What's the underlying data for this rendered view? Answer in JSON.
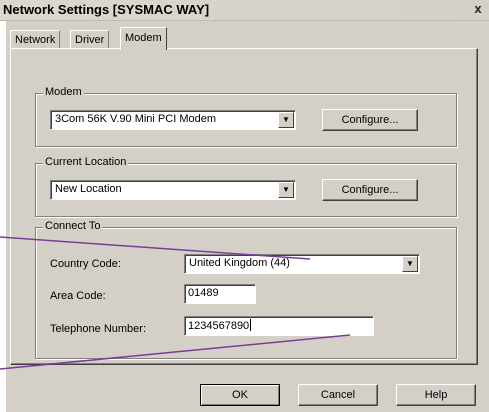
{
  "window": {
    "title": "Network Settings [SYSMAC WAY]",
    "close_glyph": "x"
  },
  "tabs": [
    "Network",
    "Driver",
    "Modem"
  ],
  "modem_group": {
    "legend": "Modem",
    "selected": "3Com 56K V.90 Mini PCI Modem",
    "configure_label": "Configure..."
  },
  "location_group": {
    "legend": "Current Location",
    "selected": "New Location",
    "configure_label": "Configure..."
  },
  "connect_group": {
    "legend": "Connect To",
    "country_label": "Country Code:",
    "country_value": "United Kingdom (44)",
    "area_label": "Area Code:",
    "area_value": "01489",
    "phone_label": "Telephone Number:",
    "phone_value": "1234567890"
  },
  "buttons": {
    "ok": "OK",
    "cancel": "Cancel",
    "help": "Help"
  },
  "colors": {
    "dialog_bg": "#d4d0c8",
    "callout_line": "#7a3c96"
  }
}
